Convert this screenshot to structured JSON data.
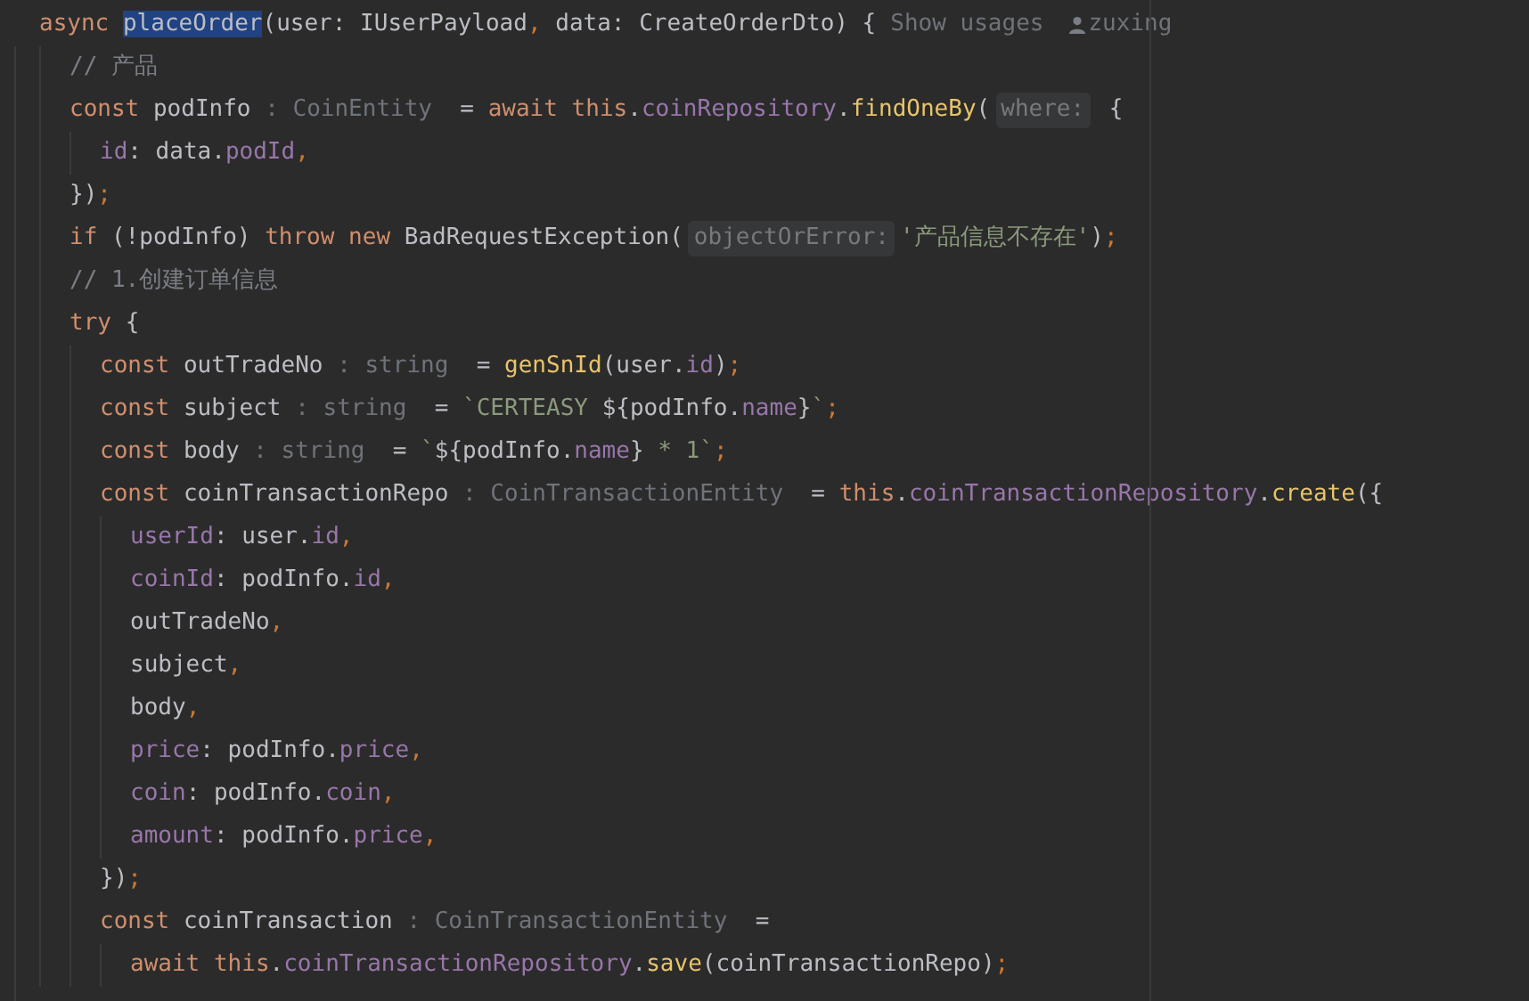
{
  "editor": {
    "lines": [
      {
        "tokens": [
          {
            "kind": "kw",
            "text": "async "
          },
          {
            "kind": "selection",
            "text": "placeOrder"
          },
          {
            "kind": "id",
            "text": "(user: IUserPayload"
          },
          {
            "kind": "punct",
            "text": ", "
          },
          {
            "kind": "id",
            "text": "data: CreateOrderDto) {"
          },
          {
            "kind": "usage",
            "text": "Show usages"
          },
          {
            "kind": "author",
            "text": "zuxing"
          }
        ],
        "children": [
          {
            "tokens": [
              {
                "kind": "comment",
                "text": "// 产品"
              }
            ]
          },
          {
            "tokens": [
              {
                "kind": "kw",
                "text": "const "
              },
              {
                "kind": "id",
                "text": "podInfo"
              },
              {
                "kind": "type",
                "text": " : CoinEntity "
              },
              {
                "kind": "id",
                "text": " = "
              },
              {
                "kind": "kw",
                "text": "await this"
              },
              {
                "kind": "id",
                "text": "."
              },
              {
                "kind": "prop",
                "text": "coinRepository"
              },
              {
                "kind": "id",
                "text": "."
              },
              {
                "kind": "fn",
                "text": "findOneBy"
              },
              {
                "kind": "id",
                "text": "("
              },
              {
                "kind": "hint",
                "text": "where:"
              },
              {
                "kind": "id",
                "text": " {"
              }
            ],
            "children": [
              {
                "tokens": [
                  {
                    "kind": "prop",
                    "text": "id"
                  },
                  {
                    "kind": "id",
                    "text": ": data."
                  },
                  {
                    "kind": "prop",
                    "text": "podId"
                  },
                  {
                    "kind": "punct",
                    "text": ","
                  }
                ]
              }
            ]
          },
          {
            "tokens": [
              {
                "kind": "id",
                "text": "})"
              },
              {
                "kind": "punct",
                "text": ";"
              }
            ]
          },
          {
            "tokens": [
              {
                "kind": "kw",
                "text": "if "
              },
              {
                "kind": "id",
                "text": "(!podInfo) "
              },
              {
                "kind": "kw",
                "text": "throw new "
              },
              {
                "kind": "id",
                "text": "BadRequestException("
              },
              {
                "kind": "hint",
                "text": "objectOrError:"
              },
              {
                "kind": "str",
                "text": "'产品信息不存在'"
              },
              {
                "kind": "id",
                "text": ")"
              },
              {
                "kind": "punct",
                "text": ";"
              }
            ]
          },
          {
            "tokens": [
              {
                "kind": "comment",
                "text": "// 1.创建订单信息"
              }
            ]
          },
          {
            "tokens": [
              {
                "kind": "kw",
                "text": "try "
              },
              {
                "kind": "id",
                "text": "{"
              }
            ],
            "children": [
              {
                "tokens": [
                  {
                    "kind": "kw",
                    "text": "const "
                  },
                  {
                    "kind": "id",
                    "text": "outTradeNo"
                  },
                  {
                    "kind": "type",
                    "text": " : string "
                  },
                  {
                    "kind": "id",
                    "text": " = "
                  },
                  {
                    "kind": "fn",
                    "text": "genSnId"
                  },
                  {
                    "kind": "id",
                    "text": "(user."
                  },
                  {
                    "kind": "prop",
                    "text": "id"
                  },
                  {
                    "kind": "id",
                    "text": ")"
                  },
                  {
                    "kind": "punct",
                    "text": ";"
                  }
                ]
              },
              {
                "tokens": [
                  {
                    "kind": "kw",
                    "text": "const "
                  },
                  {
                    "kind": "id",
                    "text": "subject"
                  },
                  {
                    "kind": "type",
                    "text": " : string "
                  },
                  {
                    "kind": "id",
                    "text": " = "
                  },
                  {
                    "kind": "str",
                    "text": "`CERTEASY "
                  },
                  {
                    "kind": "id",
                    "text": "${podInfo."
                  },
                  {
                    "kind": "prop",
                    "text": "name"
                  },
                  {
                    "kind": "id",
                    "text": "}"
                  },
                  {
                    "kind": "str",
                    "text": "`"
                  },
                  {
                    "kind": "punct",
                    "text": ";"
                  }
                ]
              },
              {
                "tokens": [
                  {
                    "kind": "kw",
                    "text": "const "
                  },
                  {
                    "kind": "id",
                    "text": "body"
                  },
                  {
                    "kind": "type",
                    "text": " : string "
                  },
                  {
                    "kind": "id",
                    "text": " = "
                  },
                  {
                    "kind": "str",
                    "text": "`"
                  },
                  {
                    "kind": "id",
                    "text": "${podInfo."
                  },
                  {
                    "kind": "prop",
                    "text": "name"
                  },
                  {
                    "kind": "id",
                    "text": "}"
                  },
                  {
                    "kind": "str",
                    "text": " * 1`"
                  },
                  {
                    "kind": "punct",
                    "text": ";"
                  }
                ]
              },
              {
                "tokens": [
                  {
                    "kind": "kw",
                    "text": "const "
                  },
                  {
                    "kind": "id",
                    "text": "coinTransactionRepo"
                  },
                  {
                    "kind": "type",
                    "text": " : CoinTransactionEntity "
                  },
                  {
                    "kind": "id",
                    "text": " = "
                  },
                  {
                    "kind": "kw",
                    "text": "this"
                  },
                  {
                    "kind": "id",
                    "text": "."
                  },
                  {
                    "kind": "prop",
                    "text": "coinTransactionRepository"
                  },
                  {
                    "kind": "id",
                    "text": "."
                  },
                  {
                    "kind": "fn",
                    "text": "create"
                  },
                  {
                    "kind": "id",
                    "text": "({"
                  }
                ],
                "children": [
                  {
                    "tokens": [
                      {
                        "kind": "prop",
                        "text": "userId"
                      },
                      {
                        "kind": "id",
                        "text": ": user."
                      },
                      {
                        "kind": "prop",
                        "text": "id"
                      },
                      {
                        "kind": "punct",
                        "text": ","
                      }
                    ]
                  },
                  {
                    "tokens": [
                      {
                        "kind": "prop",
                        "text": "coinId"
                      },
                      {
                        "kind": "id",
                        "text": ": podInfo."
                      },
                      {
                        "kind": "prop",
                        "text": "id"
                      },
                      {
                        "kind": "punct",
                        "text": ","
                      }
                    ]
                  },
                  {
                    "tokens": [
                      {
                        "kind": "id",
                        "text": "outTradeNo"
                      },
                      {
                        "kind": "punct",
                        "text": ","
                      }
                    ]
                  },
                  {
                    "tokens": [
                      {
                        "kind": "id",
                        "text": "subject"
                      },
                      {
                        "kind": "punct",
                        "text": ","
                      }
                    ]
                  },
                  {
                    "tokens": [
                      {
                        "kind": "id",
                        "text": "body"
                      },
                      {
                        "kind": "punct",
                        "text": ","
                      }
                    ]
                  },
                  {
                    "tokens": [
                      {
                        "kind": "prop",
                        "text": "price"
                      },
                      {
                        "kind": "id",
                        "text": ": podInfo."
                      },
                      {
                        "kind": "prop",
                        "text": "price"
                      },
                      {
                        "kind": "punct",
                        "text": ","
                      }
                    ]
                  },
                  {
                    "tokens": [
                      {
                        "kind": "prop",
                        "text": "coin"
                      },
                      {
                        "kind": "id",
                        "text": ": podInfo."
                      },
                      {
                        "kind": "prop",
                        "text": "coin"
                      },
                      {
                        "kind": "punct",
                        "text": ","
                      }
                    ]
                  },
                  {
                    "tokens": [
                      {
                        "kind": "prop",
                        "text": "amount"
                      },
                      {
                        "kind": "id",
                        "text": ": podInfo."
                      },
                      {
                        "kind": "prop",
                        "text": "price"
                      },
                      {
                        "kind": "punct",
                        "text": ","
                      }
                    ]
                  }
                ]
              },
              {
                "tokens": [
                  {
                    "kind": "id",
                    "text": "})"
                  },
                  {
                    "kind": "punct",
                    "text": ";"
                  }
                ]
              },
              {
                "tokens": [
                  {
                    "kind": "kw",
                    "text": "const "
                  },
                  {
                    "kind": "id",
                    "text": "coinTransaction"
                  },
                  {
                    "kind": "type",
                    "text": " : CoinTransactionEntity "
                  },
                  {
                    "kind": "id",
                    "text": " ="
                  }
                ],
                "children": [
                  {
                    "tokens": [
                      {
                        "kind": "kw",
                        "text": "await this"
                      },
                      {
                        "kind": "id",
                        "text": "."
                      },
                      {
                        "kind": "prop",
                        "text": "coinTransactionRepository"
                      },
                      {
                        "kind": "id",
                        "text": "."
                      },
                      {
                        "kind": "fn",
                        "text": "save"
                      },
                      {
                        "kind": "id",
                        "text": "(coinTransactionRepo)"
                      },
                      {
                        "kind": "punct",
                        "text": ";"
                      }
                    ]
                  }
                ]
              }
            ]
          }
        ]
      }
    ]
  }
}
